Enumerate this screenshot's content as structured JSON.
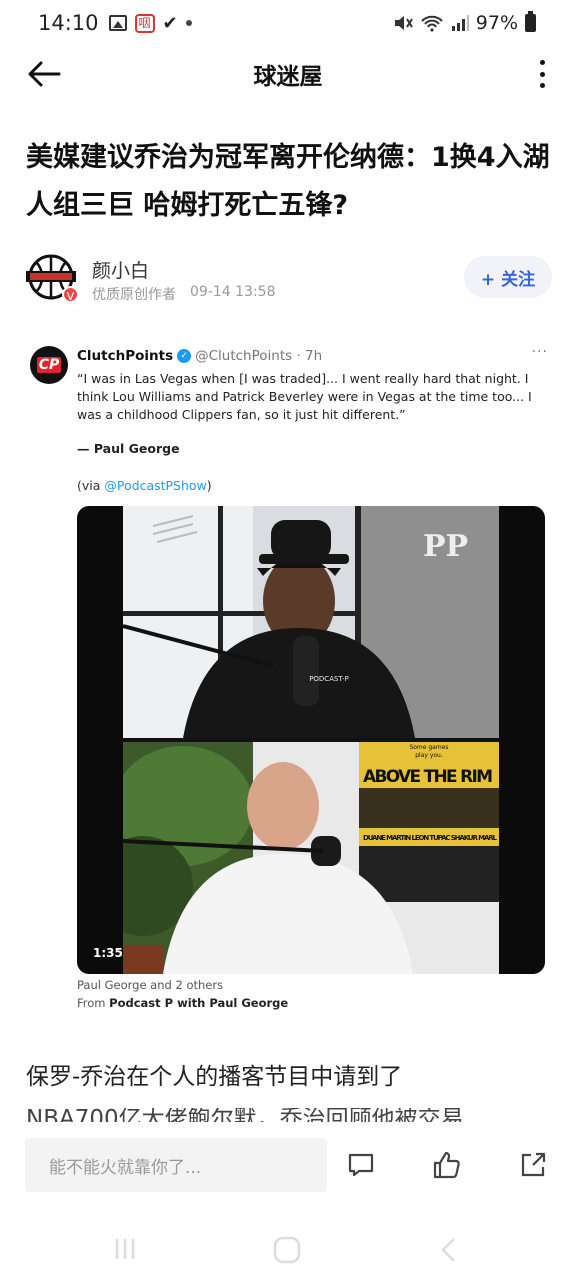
{
  "status_bar": {
    "time": "14:10",
    "badge": "咽",
    "battery": "97%"
  },
  "nav": {
    "title": "球迷屋"
  },
  "article": {
    "title": "美媒建议乔治为冠军离开伦纳德：1换4入湖人组三巨 哈姆打死亡五锋?",
    "author": {
      "name": "颜小白",
      "badge": "优质原创作者",
      "date": "09-14 13:58",
      "follow_label": "+ 关注"
    },
    "body_first_line": "保罗-乔治在个人的播客节目中请到了",
    "body_cut_line": "NBA700亿大佬鲍尔默，乔治回顾他被交易"
  },
  "tweet": {
    "logo_text": "CP",
    "name": "ClutchPoints",
    "handle": "@ClutchPoints · 7h",
    "more": "···",
    "text": "“I was in Las Vegas when [I was traded]... I went really hard that night. I think Lou Williams and Patrick Beverley were in Vegas at the time too... I was a childhood Clippers fan, so it just hit different.”",
    "attribution": "— Paul George",
    "via_prefix": "(via ",
    "via_link": "@PodcastPShow",
    "via_suffix": ")",
    "video": {
      "duration": "1:35",
      "poster_top": "Some games",
      "poster_top2": "play you.",
      "poster_title": "ABOVE THE RIM",
      "poster_cast": "DUANE MARTIN  LEON  TUPAC SHAKUR  MARL",
      "cap_text": "PODCAST-P",
      "brand": "PP"
    },
    "caption_line1": "Paul George and 2 others",
    "caption_from": "From ",
    "caption_show": "Podcast P with Paul George"
  },
  "bottom_bar": {
    "comment_placeholder": "能不能火就靠你了..."
  },
  "colors": {
    "accent": "#3a63d8",
    "link": "#1d9bf0",
    "muted": "#999999"
  },
  "icons": [
    "back-arrow-icon",
    "more-vertical-icon",
    "comment-icon",
    "thumbs-up-icon",
    "share-icon"
  ]
}
